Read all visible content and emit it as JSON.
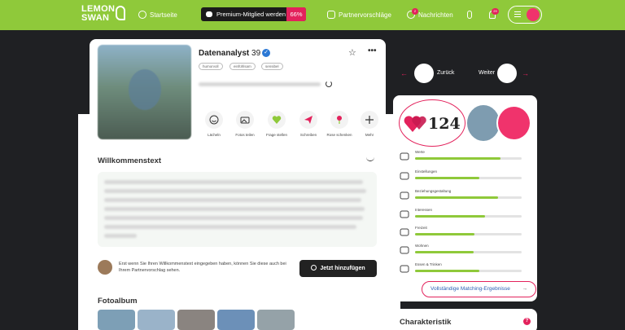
{
  "header": {
    "logo_line1": "LEMON",
    "logo_line2": "SWAN",
    "nav_home": "Startseite",
    "premium_label": "Premium-Mitglied werden",
    "premium_percent": "66%",
    "nav_suggestions": "Partnervorschläge",
    "nav_messages": "Nachrichten",
    "messages_badge": "2",
    "notifications_badge": "29"
  },
  "profile": {
    "name": "Datenanalyst",
    "age": "39",
    "tags": [
      "humorvoll",
      "einfühlsam",
      "sensibel"
    ],
    "actions": [
      {
        "label": "Lächeln",
        "icon": "smile-icon"
      },
      {
        "label": "Fotos teilen",
        "icon": "photos-icon"
      },
      {
        "label": "Frage stellen",
        "icon": "heart-question-icon"
      },
      {
        "label": "Schreiben",
        "icon": "paper-plane-icon"
      },
      {
        "label": "Rose schenken",
        "icon": "rose-icon"
      },
      {
        "label": "Mehr",
        "icon": "plus-icon"
      }
    ]
  },
  "welcome": {
    "title": "Willkommenstext",
    "info": "Erst wenn Sie Ihren Willkommenstext eingegeben haben, können Sie diese auch bei Ihrem Partnervorschlag sehen.",
    "button": "Jetzt hinzufügen"
  },
  "album": {
    "title": "Fotoalbum"
  },
  "navigation": {
    "back": "Zurück",
    "next": "Weiter"
  },
  "matching": {
    "score": "124",
    "categories": [
      {
        "label": "Werte",
        "icon": "scale-icon",
        "fraction": 0.8
      },
      {
        "label": "Einstellungen",
        "icon": "compass-icon",
        "fraction": 0.6
      },
      {
        "label": "Beziehungsgestaltung",
        "icon": "couch-icon",
        "fraction": 0.78
      },
      {
        "label": "Interessen",
        "icon": "bike-icon",
        "fraction": 0.66
      },
      {
        "label": "Freizeit",
        "icon": "cocktail-icon",
        "fraction": 0.56
      },
      {
        "label": "Wohnen",
        "icon": "house-icon",
        "fraction": 0.55
      },
      {
        "label": "Essen & Trinken",
        "icon": "bowl-icon",
        "fraction": 0.6
      }
    ],
    "full_results": "Vollständige Matching-Ergebnisse"
  },
  "charakteristik": {
    "title": "Charakteristik"
  },
  "colors": {
    "brand_green": "#8fc93a",
    "accent_pink": "#e3225c",
    "background_dark": "#1f2023"
  }
}
